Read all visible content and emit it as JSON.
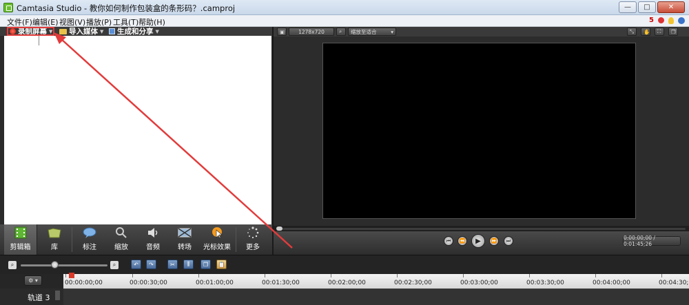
{
  "window": {
    "title": "Camtasia Studio - 教你如何制作包装盒的条形码？.camproj",
    "minimize": "—",
    "maximize": "□",
    "close": "✕"
  },
  "menu": {
    "items": [
      "文件(F)",
      "编辑(E)",
      "视图(V)",
      "播放(P)",
      "工具(T)",
      "帮助(H)"
    ],
    "notification_count": "5"
  },
  "toolbar": {
    "record": "录制屏幕",
    "import": "导入媒体",
    "produce": "生成和分享"
  },
  "task_tabs": [
    "剪辑箱",
    "库",
    "标注",
    "缩放",
    "音频",
    "转场",
    "光标效果",
    "更多"
  ],
  "preview": {
    "resolution": "1278x720",
    "fit": "缩放至适合",
    "time": "0:00:00;00 / 0:01:45;26"
  },
  "timeline": {
    "ticks": [
      "00:00:00;00",
      "00:00:30;00",
      "00:01:00;00",
      "00:01:30;00",
      "00:02:00;00",
      "00:02:30;00",
      "00:03:00;00",
      "00:03:30;00",
      "00:04:00;00",
      "00:04:30;00"
    ],
    "track_label": "轨道 3"
  },
  "colors": {
    "annotation": "#e23b3b",
    "record": "#d62010"
  }
}
